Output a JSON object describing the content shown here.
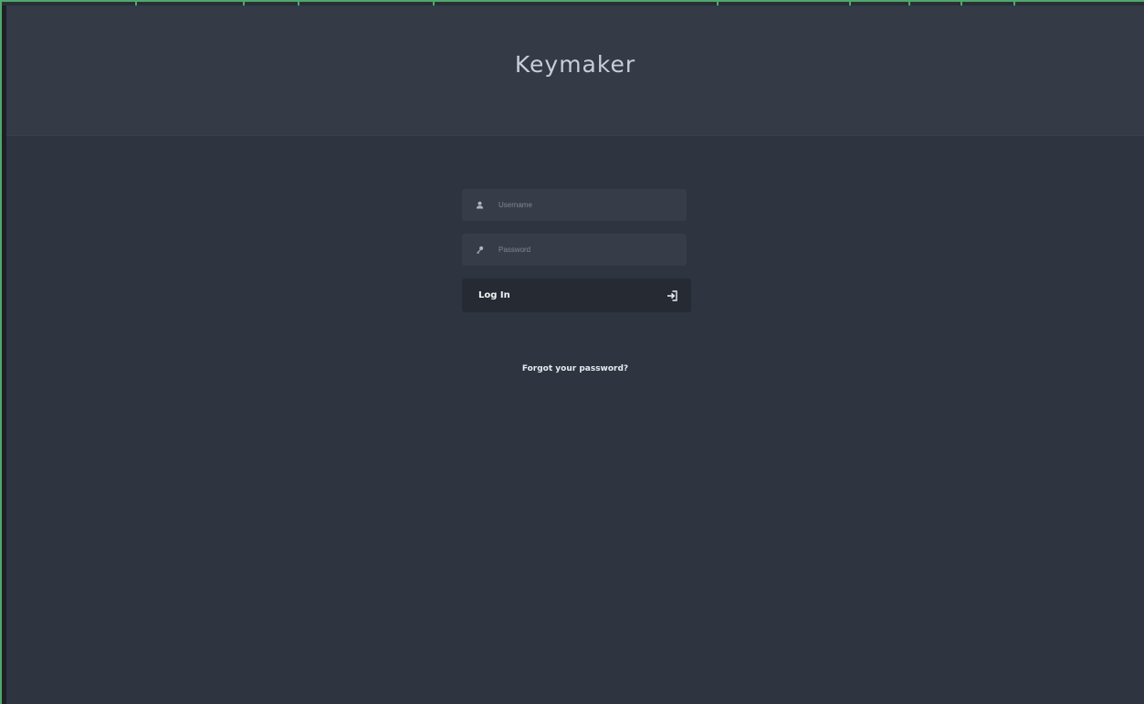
{
  "app": {
    "title": "Keymaker"
  },
  "login": {
    "username": {
      "placeholder": "Username",
      "value": "",
      "icon": "user-icon"
    },
    "password": {
      "placeholder": "Password",
      "value": "",
      "icon": "key-icon"
    },
    "submit": {
      "label": "Log In",
      "icon": "sign-in-icon"
    },
    "forgot_link": "Forgot your password?"
  },
  "colors": {
    "background": "#2e3440",
    "header": "#343b47",
    "field": "#363d49",
    "button": "#262b33",
    "frame_accent": "#4fa86a"
  }
}
